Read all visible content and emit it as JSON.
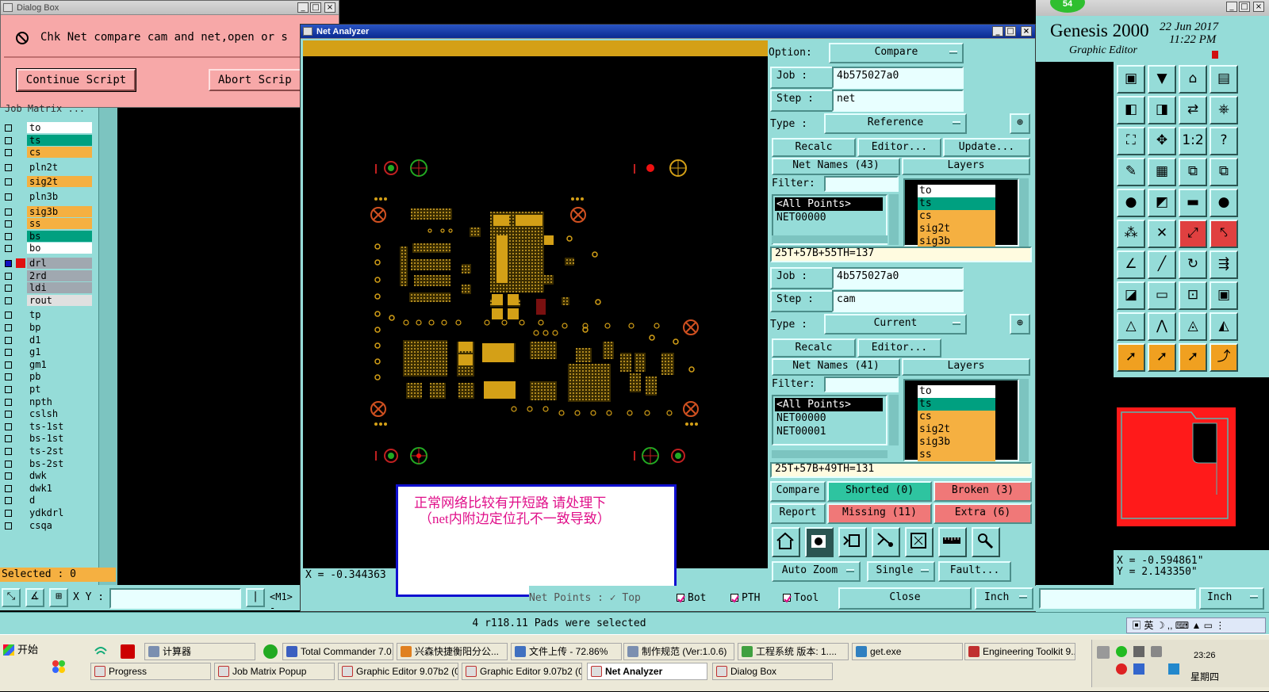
{
  "dialog_box": {
    "title": "Dialog Box",
    "message": "Chk Net compare cam and net,open or s",
    "continue_label": "Continue Script",
    "abort_label": "Abort Scrip"
  },
  "layer_list": {
    "header": "Job Matrix ...",
    "layers": [
      {
        "name": "to",
        "color": "#ffffff"
      },
      {
        "name": "ts",
        "color": "#00a080"
      },
      {
        "name": "cs",
        "color": "#f5b041"
      },
      {
        "name": "pln2t",
        "color": "#95dcd8"
      },
      {
        "name": "sig2t",
        "color": "#f5b041"
      },
      {
        "name": "pln3b",
        "color": "#95dcd8"
      },
      {
        "name": "sig3b",
        "color": "#f5b041"
      },
      {
        "name": "ss",
        "color": "#f5b041"
      },
      {
        "name": "bs",
        "color": "#00a080"
      },
      {
        "name": "bo",
        "color": "#ffffff"
      },
      {
        "name": "drl",
        "color": "#a0a8b0"
      },
      {
        "name": "2rd",
        "color": "#a0a8b0"
      },
      {
        "name": "ldi",
        "color": "#a0a8b0"
      },
      {
        "name": "rout",
        "color": "#e0e0e0"
      },
      {
        "name": "tp",
        "color": "#95dcd8"
      },
      {
        "name": "bp",
        "color": "#95dcd8"
      },
      {
        "name": "d1",
        "color": "#95dcd8"
      },
      {
        "name": "g1",
        "color": "#95dcd8"
      },
      {
        "name": "gm1",
        "color": "#95dcd8"
      },
      {
        "name": "pb",
        "color": "#95dcd8"
      },
      {
        "name": "pt",
        "color": "#95dcd8"
      },
      {
        "name": "npth",
        "color": "#95dcd8"
      },
      {
        "name": "cslsh",
        "color": "#95dcd8"
      },
      {
        "name": "ts-1st",
        "color": "#95dcd8"
      },
      {
        "name": "bs-1st",
        "color": "#95dcd8"
      },
      {
        "name": "ts-2st",
        "color": "#95dcd8"
      },
      {
        "name": "bs-2st",
        "color": "#95dcd8"
      },
      {
        "name": "dwk",
        "color": "#95dcd8"
      },
      {
        "name": "dwk1",
        "color": "#95dcd8"
      },
      {
        "name": "d",
        "color": "#95dcd8"
      },
      {
        "name": "ydkdrl",
        "color": "#95dcd8"
      },
      {
        "name": "csqa",
        "color": "#95dcd8"
      }
    ],
    "selected": "Selected : 0",
    "xy_label": "X Y :",
    "m1_label": "<M1> -"
  },
  "net_analyzer": {
    "title": "Net Analyzer",
    "coord_readout": "X = -0.344363",
    "annotation_line1": "正常网络比较有开短路   请处理下",
    "annotation_line2": "（net内附边定位孔不一致导致）",
    "option_label": "Option:",
    "option_value": "Compare",
    "ref": {
      "job_label": "Job   :",
      "job_value": "4b575027a0",
      "step_label": "Step  :",
      "step_value": "net",
      "type_label": "Type  :",
      "type_value": "Reference",
      "recalc": "Recalc",
      "editor": "Editor...",
      "update": "Update...",
      "net_names": "Net Names (43)",
      "layers_header": "Layers",
      "filter_label": "Filter:",
      "nets": [
        "<All Points>",
        "NET00000"
      ],
      "layers": [
        {
          "name": "to",
          "color": "#ffffff"
        },
        {
          "name": "ts",
          "color": "#00a080"
        },
        {
          "name": "cs",
          "color": "#f5b041"
        },
        {
          "name": "sig2t",
          "color": "#f5b041"
        },
        {
          "name": "sig3b",
          "color": "#f5b041"
        }
      ],
      "summary": "25T+57B+55TH=137"
    },
    "cur": {
      "job_label": "Job   :",
      "job_value": "4b575027a0",
      "step_label": "Step  :",
      "step_value": "cam",
      "type_label": "Type  :",
      "type_value": "Current",
      "recalc": "Recalc",
      "editor": "Editor...",
      "net_names": "Net Names (41)",
      "layers_header": "Layers",
      "filter_label": "Filter:",
      "nets": [
        "<All Points>",
        "NET00000",
        "NET00001"
      ],
      "layers": [
        {
          "name": "to",
          "color": "#ffffff"
        },
        {
          "name": "ts",
          "color": "#00a080"
        },
        {
          "name": "cs",
          "color": "#f5b041"
        },
        {
          "name": "sig2t",
          "color": "#f5b041"
        },
        {
          "name": "sig3b",
          "color": "#f5b041"
        },
        {
          "name": "ss",
          "color": "#f5b041"
        }
      ],
      "summary": "25T+57B+49TH=131"
    },
    "compare": "Compare",
    "shorted": "Shorted (0)",
    "broken": "Broken (3)",
    "report": "Report",
    "missing": "Missing (11)",
    "extra": "Extra (6)",
    "auto_zoom": "Auto Zoom",
    "single": "Single",
    "fault": "Fault...",
    "bottom_strip": "Net Points : ✓ Top",
    "bot": "Bot",
    "pth": "PTH",
    "tool": "Tool",
    "close": "Close",
    "inch": "Inch"
  },
  "genesis": {
    "badge": "54",
    "title": "Genesis 2000",
    "subtitle": "Graphic Editor",
    "date": "22 Jun 2017",
    "time": "11:22 PM",
    "x_readout": "X = -0.594861\"",
    "y_readout": "Y =  2.143350\"",
    "inch": "Inch"
  },
  "status_bar": {
    "message": "4 r118.11 Pads were selected"
  },
  "taskbar": {
    "start": "开始",
    "row1": [
      {
        "label": "计算器",
        "color": "#7b8fb0"
      },
      {
        "label": "Total Commander 7.0...",
        "color": "#3b5fc0"
      },
      {
        "label": "兴森快捷衡阳分公...",
        "color": "#e08020"
      },
      {
        "label": "文件上传 - 72.86%",
        "color": "#4070c0"
      },
      {
        "label": "制作规范 (Ver:1.0.6)",
        "color": "#7b8fb0"
      },
      {
        "label": "工程系统  版本: 1....",
        "color": "#40a040"
      },
      {
        "label": "get.exe",
        "color": "#3080c0"
      },
      {
        "label": "Engineering Toolkit 9....",
        "color": "#c03030"
      }
    ],
    "row2": [
      {
        "label": "Progress",
        "color": "#c03030"
      },
      {
        "label": "Job Matrix Popup",
        "color": "#c03030"
      },
      {
        "label": "Graphic Editor 9.07b2 (0...",
        "color": "#c03030"
      },
      {
        "label": "Graphic Editor 9.07b2 (0...",
        "color": "#c03030"
      },
      {
        "label": "Net Analyzer",
        "color": "#c03030"
      },
      {
        "label": "Dialog Box",
        "color": "#c03030"
      }
    ],
    "ime": "英",
    "clock": "23:26",
    "weekday": "星期四"
  }
}
